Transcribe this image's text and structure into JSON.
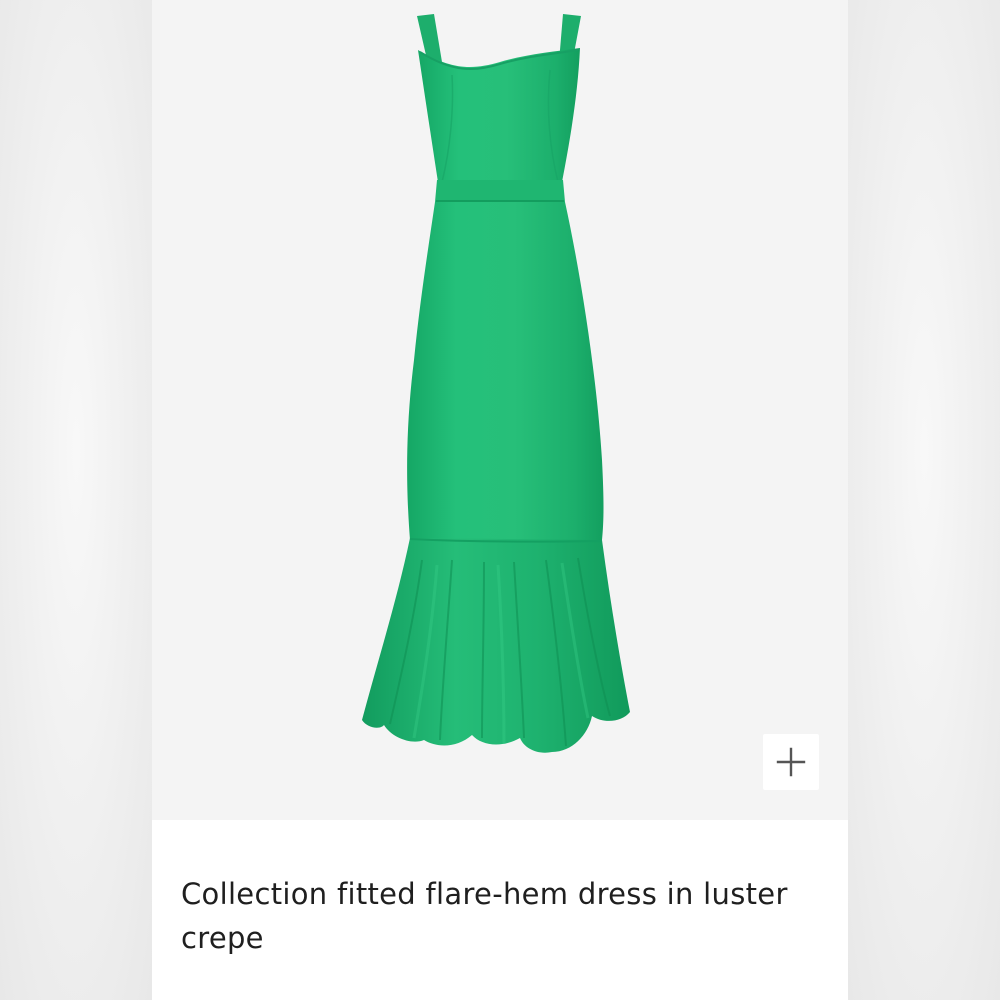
{
  "product": {
    "title": "Collection fitted flare-hem dress in luster crepe",
    "image_alt": "Green fitted flare-hem dress",
    "color": "#22b573"
  },
  "actions": {
    "add_icon": "plus-icon"
  }
}
